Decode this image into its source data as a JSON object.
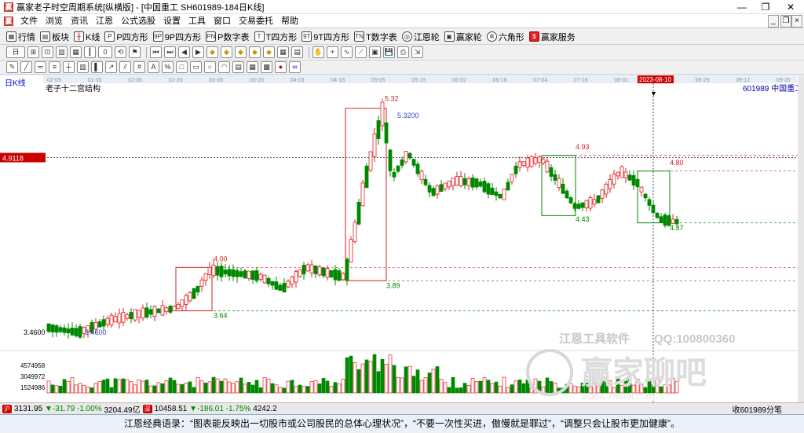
{
  "window": {
    "title": "赢家老子时空周期系统[纵横版] - [中国重工  SH601989-184日K线]",
    "controls": [
      "—",
      "❐",
      "✕"
    ]
  },
  "menu": {
    "items": [
      "文件",
      "浏览",
      "资讯",
      "江恩",
      "公式选股",
      "设置",
      "工具",
      "窗口",
      "交易委托",
      "帮助"
    ],
    "mdi_controls": [
      "_",
      "❐",
      "×"
    ]
  },
  "toolbar1": [
    {
      "icon": "grid-icon",
      "label": "行情"
    },
    {
      "icon": "blocks-icon",
      "label": "板块"
    },
    {
      "icon": "kline-icon",
      "label": "K线"
    },
    {
      "icon": "p-square-icon",
      "label": "P四方形"
    },
    {
      "icon": "9p-square-icon",
      "label": "9P四方形"
    },
    {
      "icon": "p-table-icon",
      "label": "P数字表"
    },
    {
      "icon": "t-square-icon",
      "label": "T四方形"
    },
    {
      "icon": "9t-square-icon",
      "label": "9T四方形"
    },
    {
      "icon": "t-table-icon",
      "label": "T数字表"
    },
    {
      "icon": "gann-wheel-icon",
      "label": "江恩轮"
    },
    {
      "icon": "winner-wheel-icon",
      "label": "赢家轮"
    },
    {
      "icon": "hexagon-icon",
      "label": "六角形"
    },
    {
      "icon": "service-icon",
      "label": "赢家服务"
    }
  ],
  "toolbar2": {
    "text_fields": [
      "日",
      "0"
    ]
  },
  "chart_header": {
    "period": "日K线",
    "indicator": "老子十二宫结构",
    "stock": "601989  中国重工",
    "date_labels": [
      "02-09",
      "01-30",
      "02-06",
      "02-20",
      "03-06",
      "03-20",
      "04-03",
      "04-18",
      "05-05",
      "05-19",
      "06-02",
      "06-16",
      "07-04",
      "07-18",
      "08-01",
      "08-15",
      "08-29",
      "09-12",
      "09-26"
    ],
    "cursor_date": "2023-08-10",
    "cursor_price": "4.9118",
    "vol_labels": [
      "4574958",
      "3049972",
      "1524986"
    ],
    "watermark1": "江恩工具软件",
    "watermark2": "QQ:100800360",
    "watermark3": "赢家聊吧",
    "watermark4": "laoba.v.ftsoft.com"
  },
  "chart_data": {
    "type": "candlestick",
    "title": "老子十二宫结构",
    "series_name": "中国重工 601989",
    "annotations": [
      "5.32",
      "5.3200",
      "4.00",
      "3.64",
      "3.89",
      "4.93",
      "4.43",
      "4.80",
      "4.37",
      "3.4600",
      "3.4600"
    ],
    "ylim": [
      3.35,
      5.45
    ]
  },
  "status": {
    "index1": "3131.95",
    "index1_chg": "▼-31.79",
    "index1_pct": "-1.00%",
    "index1_amt": "3204.49亿",
    "index2": "10458.51",
    "index2_chg": "▼-186.01",
    "index2_pct": "-1.75%",
    "index2_amt": "4242.2",
    "badge1": "沪",
    "badge2": "深",
    "right": "收601989分笔"
  },
  "quote": "江恩经典语录：“图表能反映出一切股市或公司股民的总体心理状况”，“不要一次性买进，傲慢就是罪过”，“调整只会让股市更加健康”。",
  "colors": {
    "up": "#e02020",
    "down": "#008800",
    "cursor": "#222222",
    "square": "#d02020"
  }
}
